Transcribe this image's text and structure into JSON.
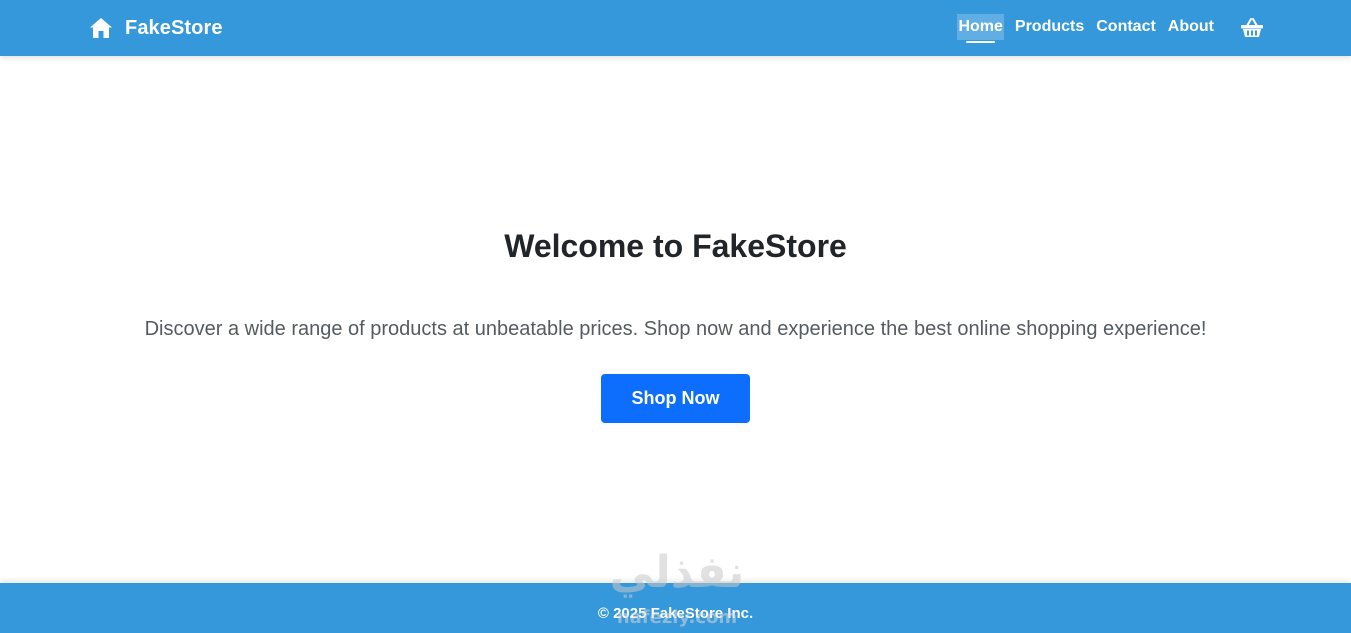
{
  "header": {
    "brand": "FakeStore",
    "brand_icon": "home-icon",
    "nav": [
      {
        "label": "Home",
        "active": true
      },
      {
        "label": "Products",
        "active": false
      },
      {
        "label": "Contact",
        "active": false
      },
      {
        "label": "About",
        "active": false
      }
    ],
    "cart_icon": "shopping-basket-icon"
  },
  "hero": {
    "title": "Welcome to FakeStore",
    "subtitle": "Discover a wide range of products at unbeatable prices. Shop now and experience the best online shopping experience!",
    "button_label": "Shop Now"
  },
  "footer": {
    "text": "© 2025 FakeStore Inc."
  },
  "watermark": {
    "arabic": "نفذلي",
    "latin": "nafezly.com"
  },
  "colors": {
    "navbar": "#3498db",
    "primary_button": "#0d6efd",
    "title_text": "#212529",
    "body_text": "#555b61"
  }
}
